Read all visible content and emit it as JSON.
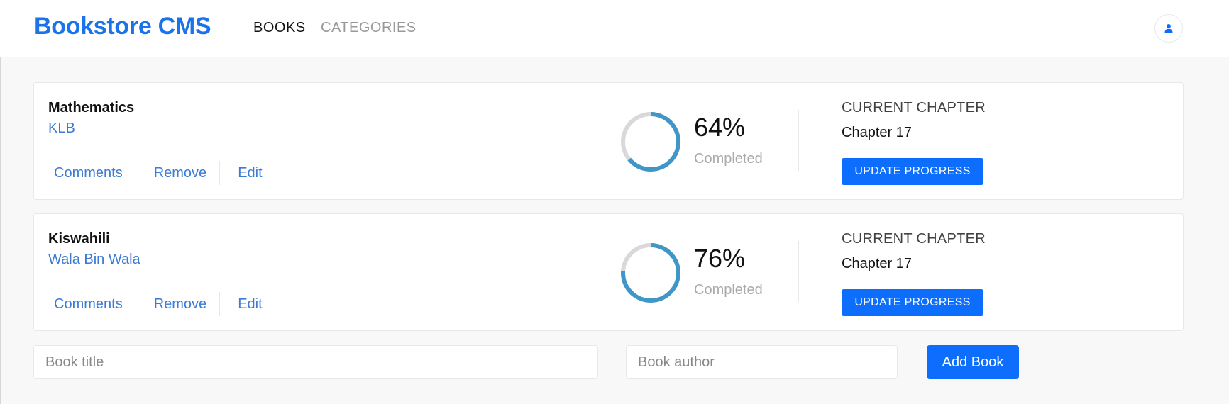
{
  "app": {
    "brand": "Bookstore CMS",
    "brand_color": "#1a73e8",
    "nav": [
      {
        "label": "BOOKS",
        "active": true
      },
      {
        "label": "CATEGORIES",
        "active": false
      }
    ],
    "user_icon": "user-icon"
  },
  "books": [
    {
      "title": "Mathematics",
      "author": "KLB",
      "actions": [
        "Comments",
        "Remove",
        "Edit"
      ],
      "progress": 64,
      "progress_text": "64%",
      "completed_label": "Completed",
      "chapter_label": "CURRENT CHAPTER",
      "chapter": "Chapter 17",
      "update_label": "UPDATE PROGRESS"
    },
    {
      "title": "Kiswahili",
      "author": "Wala Bin Wala",
      "actions": [
        "Comments",
        "Remove",
        "Edit"
      ],
      "progress": 76,
      "progress_text": "76%",
      "completed_label": "Completed",
      "chapter_label": "CURRENT CHAPTER",
      "chapter": "Chapter 17",
      "update_label": "UPDATE PROGRESS"
    }
  ],
  "form": {
    "title_placeholder": "Book title",
    "title_value": "",
    "author_placeholder": "Book author",
    "author_value": "",
    "add_label": "Add Book"
  },
  "colors": {
    "accent": "#0d6efd",
    "progress_fill": "#4196c8",
    "progress_track": "#d9d9d9",
    "link": "#3a7bd5"
  }
}
